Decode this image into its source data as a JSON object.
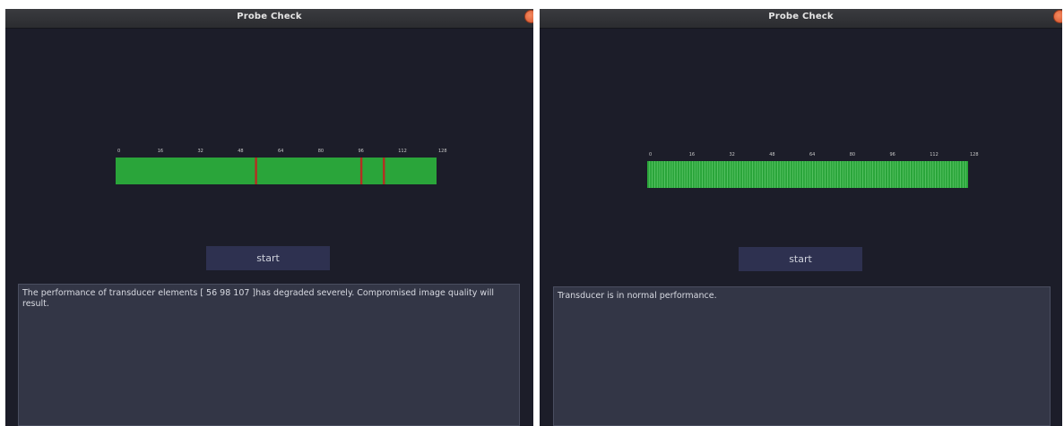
{
  "panels": [
    {
      "title": "Probe Check",
      "start_label": "start",
      "message": "The performance of transducer elements [ 56 98 107 ]has degraded severely. Compromised image quality will result.",
      "gauge": {
        "min": 0,
        "max": 128,
        "ticks": [
          0,
          16,
          32,
          48,
          64,
          80,
          96,
          112,
          128
        ],
        "tick_labels": [
          "0",
          "16",
          "32",
          "48",
          "64",
          "80",
          "96",
          "112",
          "128"
        ],
        "bad_elements": [
          56,
          98,
          107
        ],
        "show_element_lines": false,
        "colors": {
          "good": "#2aa53a",
          "bad": "#b52e21"
        }
      }
    },
    {
      "title": "Probe Check",
      "start_label": "start",
      "message": "Transducer is in normal performance.",
      "gauge": {
        "min": 0,
        "max": 128,
        "ticks": [
          0,
          16,
          32,
          48,
          64,
          80,
          96,
          112,
          128
        ],
        "tick_labels": [
          "0",
          "16",
          "32",
          "48",
          "64",
          "80",
          "96",
          "112",
          "128"
        ],
        "bad_elements": [],
        "show_element_lines": true,
        "colors": {
          "good": "#2aa53a",
          "bad": "#b52e21"
        }
      }
    }
  ]
}
